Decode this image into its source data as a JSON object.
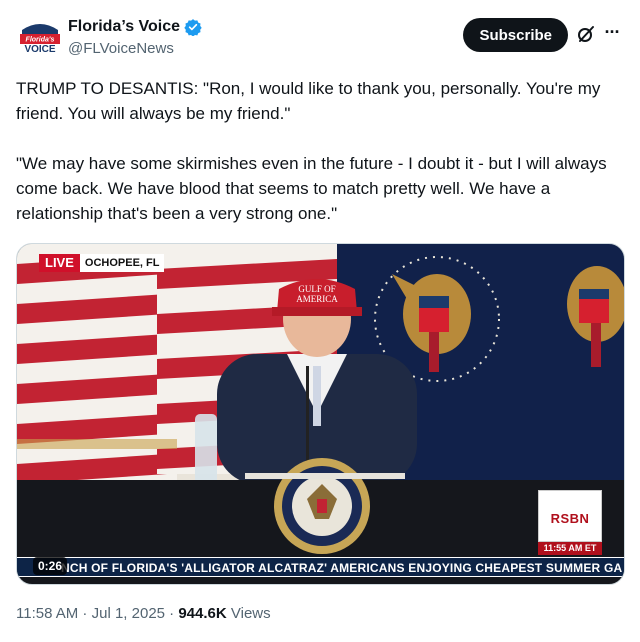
{
  "account": {
    "display_name": "Florida’s Voice",
    "handle": "@FLVoiceNews",
    "avatar_logo": {
      "line1": "Florida's",
      "line2": "VOICE"
    },
    "verified_icon": "verified-badge-icon"
  },
  "actions": {
    "subscribe_label": "Subscribe",
    "grok_icon": "slash-circle-icon",
    "more_label": "···"
  },
  "tweet": {
    "paragraphs": [
      "TRUMP TO DESANTIS: \"Ron, I would like to thank you, personally. You're my friend. You will always be my friend.\"",
      "\"We may have some skirmishes even in the future - I doubt it - but I will always come back. We have blood that seems to match pretty well. We have a relationship that's been a very strong one.\""
    ]
  },
  "video": {
    "live_label": "LIVE",
    "location": "OCHOPEE, FL",
    "hat_text_line1": "GULF OF",
    "hat_text_line2": "AMERICA",
    "seal_text": "SEAL OF THE PRESIDENT OF THE UNITED STATES",
    "rsbn_label": "RSBN",
    "rsbn_time": "11:55 AM ET",
    "ticker": "NCH OF FLORIDA'S 'ALLIGATOR ALCATRAZ'     AMERICANS ENJOYING CHEAPEST SUMMER GA",
    "duration": "0:26"
  },
  "meta": {
    "time": "11:58 AM",
    "separator": " · ",
    "date": "Jul 1, 2025",
    "views_count": "944.6K",
    "views_label": " Views"
  },
  "colors": {
    "text": "#0f1419",
    "secondary": "#536471",
    "verified": "#1d9bf0",
    "live_red": "#d0102a",
    "ticker_navy": "#0d2447"
  }
}
